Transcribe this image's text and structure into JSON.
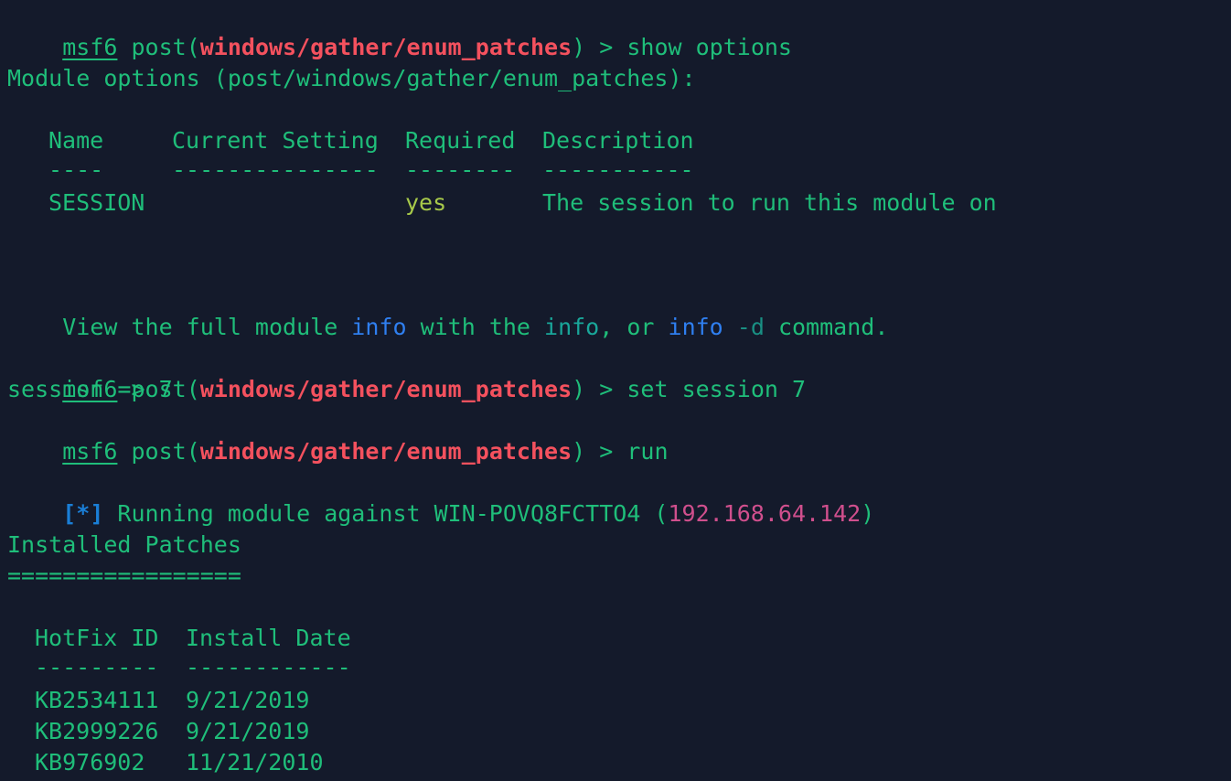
{
  "prompt": {
    "msf": "msf6",
    "post_prefix": " post(",
    "module": "windows/gather/enum_patches",
    "suffix": ") > "
  },
  "commands": {
    "show_options": "show options",
    "set_session": "set session 7",
    "run": "run"
  },
  "module_options": {
    "heading": "Module options (post/windows/gather/enum_patches):",
    "columns": [
      "Name",
      "Current Setting",
      "Required",
      "Description"
    ],
    "dashes": [
      "----",
      "---------------",
      "--------",
      "-----------"
    ],
    "rows": [
      {
        "name": "SESSION",
        "current": "",
        "required": "yes",
        "description": "The session to run this module on"
      }
    ]
  },
  "info_line": {
    "part1": "View the full module ",
    "info1": "info",
    "part2": " with the ",
    "info2": "info",
    "part3": ", or ",
    "info3": "info",
    "part4": " ",
    "flag": "-d",
    "part5": " command."
  },
  "session_output": "session => 7",
  "running": {
    "marker": "[*]",
    "text": " Running module against WIN-POVQ8FCTTO4 (",
    "ip": "192.168.64.142",
    "close": ")"
  },
  "patches": {
    "title": "Installed Patches",
    "underline": "=================",
    "columns": [
      "HotFix ID",
      "Install Date"
    ],
    "dashes": [
      "---------",
      "------------"
    ],
    "rows": [
      {
        "id": "KB2534111",
        "date": "9/21/2019"
      },
      {
        "id": "KB2999226",
        "date": "9/21/2019"
      },
      {
        "id": "KB976902",
        "date": "11/21/2010"
      }
    ]
  },
  "colors": {
    "background": "#141a2b",
    "text": "#1fbe7a",
    "module": "#f4515e",
    "yes": "#a7c94a",
    "info": "#2f7ff0",
    "ip": "#d04f8d"
  }
}
